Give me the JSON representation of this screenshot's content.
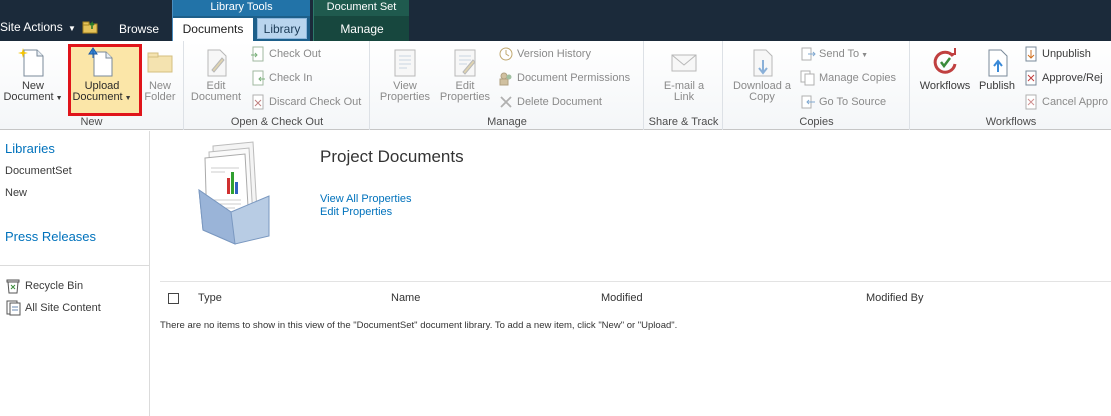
{
  "top_nav": {
    "site_actions": "Site Actions",
    "browse_tab": "Browse",
    "library_tools_label": "Library Tools",
    "documents_tab": "Documents",
    "library_tab": "Library",
    "document_set_label": "Document Set",
    "manage_tab": "Manage"
  },
  "ribbon": {
    "new_group": {
      "label": "New",
      "new_document": [
        "New",
        "Document"
      ],
      "upload_document": [
        "Upload",
        "Document"
      ],
      "new_folder": [
        "New",
        "Folder"
      ]
    },
    "open_checkout_group": {
      "label": "Open & Check Out",
      "edit_document": [
        "Edit",
        "Document"
      ],
      "check_out": "Check Out",
      "check_in": "Check In",
      "discard_check_out": "Discard Check Out"
    },
    "manage_group": {
      "label": "Manage",
      "view_properties": [
        "View",
        "Properties"
      ],
      "edit_properties": [
        "Edit",
        "Properties"
      ],
      "version_history": "Version History",
      "document_permissions": "Document Permissions",
      "delete_document": "Delete Document"
    },
    "share_track_group": {
      "label": "Share & Track",
      "email_link": [
        "E-mail a",
        "Link"
      ]
    },
    "copies_group": {
      "label": "Copies",
      "download_copy": [
        "Download a",
        "Copy"
      ],
      "send_to": "Send To",
      "manage_copies": "Manage Copies",
      "go_to_source": "Go To Source"
    },
    "workflows_group": {
      "label": "Workflows",
      "workflows": "Workflows",
      "publish": "Publish",
      "unpublish": "Unpublish",
      "approve_reject": "Approve/Rej",
      "cancel_approval": "Cancel Appro"
    }
  },
  "left_nav": {
    "libraries_heading": "Libraries",
    "items": [
      "DocumentSet",
      "New"
    ],
    "press_releases": "Press Releases",
    "recycle_bin": "Recycle Bin",
    "all_site_content": "All Site Content"
  },
  "main": {
    "title": "Project Documents",
    "view_all_properties": "View All Properties",
    "edit_properties": "Edit Properties",
    "columns": [
      "Type",
      "Name",
      "Modified",
      "Modified By"
    ],
    "empty_message": "There are no items to show in this view of the \"DocumentSet\" document library. To add a new item, click \"New\" or \"Upload\"."
  },
  "colors": {
    "top_bar": "#1b2a3a",
    "library_tools": "#2273a8",
    "document_set": "#1f5a4e",
    "link_blue": "#0072bc",
    "highlight_border": "#e0141a"
  }
}
